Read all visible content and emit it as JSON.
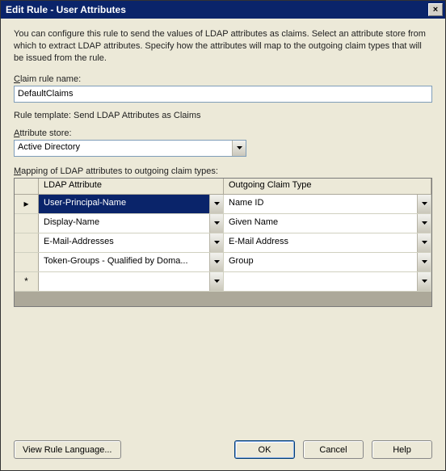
{
  "window": {
    "title": "Edit Rule - User Attributes",
    "close": "×"
  },
  "description": "You can configure this rule to send the values of LDAP attributes as claims. Select an attribute store from which to extract LDAP attributes. Specify how the attributes will map to the outgoing claim types that will be issued from the rule.",
  "ruleName": {
    "labelPrefix": "C",
    "labelRest": "laim rule name:",
    "value": "DefaultClaims"
  },
  "template": "Rule template: Send LDAP Attributes as Claims",
  "store": {
    "labelPrefix": "A",
    "labelRest": "ttribute store:",
    "value": "Active Directory"
  },
  "mapping": {
    "labelPrefix": "M",
    "labelRest": "apping of LDAP attributes to outgoing claim types:",
    "headers": {
      "ldap": "LDAP Attribute",
      "claim": "Outgoing Claim Type"
    },
    "rows": [
      {
        "marker": "▸",
        "ldap": "User-Principal-Name",
        "claim": "Name ID",
        "selected": true
      },
      {
        "marker": "",
        "ldap": "Display-Name",
        "claim": "Given Name",
        "selected": false
      },
      {
        "marker": "",
        "ldap": "E-Mail-Addresses",
        "claim": "E-Mail Address",
        "selected": false
      },
      {
        "marker": "",
        "ldap": "Token-Groups - Qualified by Doma...",
        "claim": "Group",
        "selected": false
      },
      {
        "marker": "*",
        "ldap": "",
        "claim": "",
        "selected": false
      }
    ]
  },
  "buttons": {
    "viewRule": "View Rule Language...",
    "ok": "OK",
    "cancel": "Cancel",
    "help": "Help"
  }
}
